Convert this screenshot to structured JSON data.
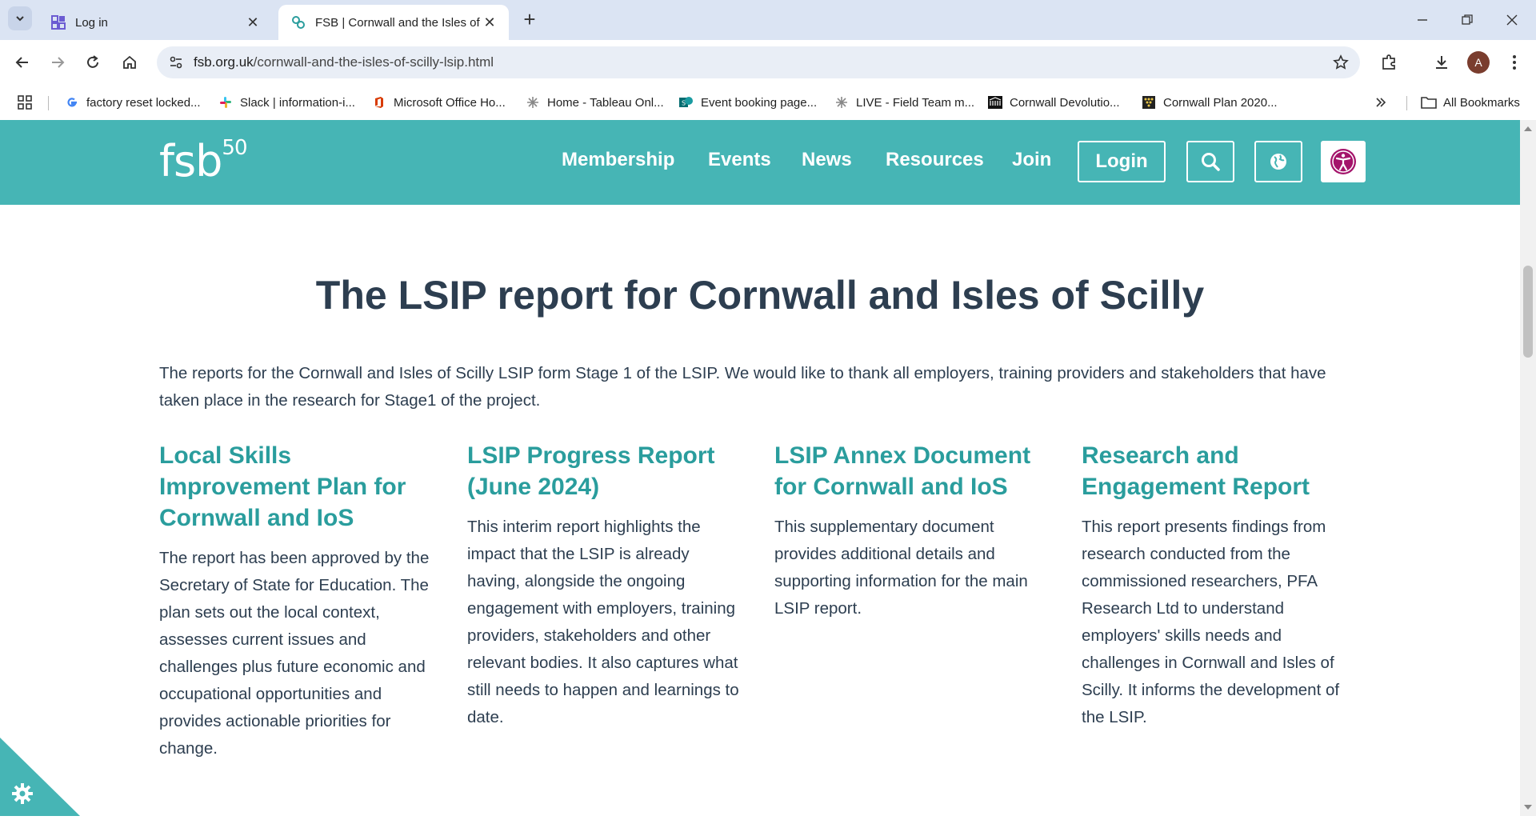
{
  "browser": {
    "tabs": [
      {
        "title": "Log in",
        "active": false
      },
      {
        "title": "FSB | Cornwall and the Isles of Scilly",
        "active": true
      }
    ],
    "url_domain": "fsb.org.uk",
    "url_path": "/cornwall-and-the-isles-of-scilly-lsip.html",
    "avatar_letter": "A",
    "bookmarks": [
      {
        "label": "factory reset locked...",
        "icon": "google-icon"
      },
      {
        "label": "Slack | information-i...",
        "icon": "slack-icon"
      },
      {
        "label": "Microsoft Office Ho...",
        "icon": "office-icon"
      },
      {
        "label": "Home - Tableau Onl...",
        "icon": "tableau-icon"
      },
      {
        "label": "Event booking page...",
        "icon": "sharepoint-icon"
      },
      {
        "label": "LIVE - Field Team m...",
        "icon": "tableau-icon"
      },
      {
        "label": "Cornwall Devolutio...",
        "icon": "council-icon"
      },
      {
        "label": "Cornwall Plan 2020...",
        "icon": "council-icon"
      }
    ],
    "all_bookmarks_label": "All Bookmarks"
  },
  "site": {
    "logo_text": "fsb",
    "logo_sup": "50",
    "nav": [
      "Membership",
      "Events",
      "News",
      "Resources",
      "Join"
    ],
    "login_label": "Login",
    "brand_color": "#46b5b5"
  },
  "page": {
    "title": "The LSIP report for Cornwall and Isles of Scilly",
    "intro": "The reports for the Cornwall and Isles of Scilly LSIP form Stage 1 of the LSIP. We would like to thank all employers, training providers and stakeholders that have taken place in the research for Stage1 of the project.",
    "columns": [
      {
        "heading": "Local Skills Improvement Plan for Cornwall and IoS",
        "body": "The report has been approved by the Secretary of State for Education. The plan sets out the local context, assesses current issues and challenges plus future economic and occupational opportunities and provides actionable priorities for change."
      },
      {
        "heading": "LSIP Progress Report (June 2024)",
        "body": "This interim report highlights the impact that the LSIP is already having, alongside the ongoing engagement with employers, training providers, stakeholders and other relevant bodies. It also captures what still needs to happen and learnings to date."
      },
      {
        "heading": "LSIP Annex Document for Cornwall and IoS",
        "body": "This supplementary document provides additional details and supporting information for the main LSIP report."
      },
      {
        "heading": "Research and Engagement Report",
        "body": "This report presents findings from research conducted from the commissioned researchers, PFA Research Ltd to understand employers' skills needs and challenges in Cornwall and Isles of Scilly. It informs the development of the LSIP."
      }
    ]
  }
}
